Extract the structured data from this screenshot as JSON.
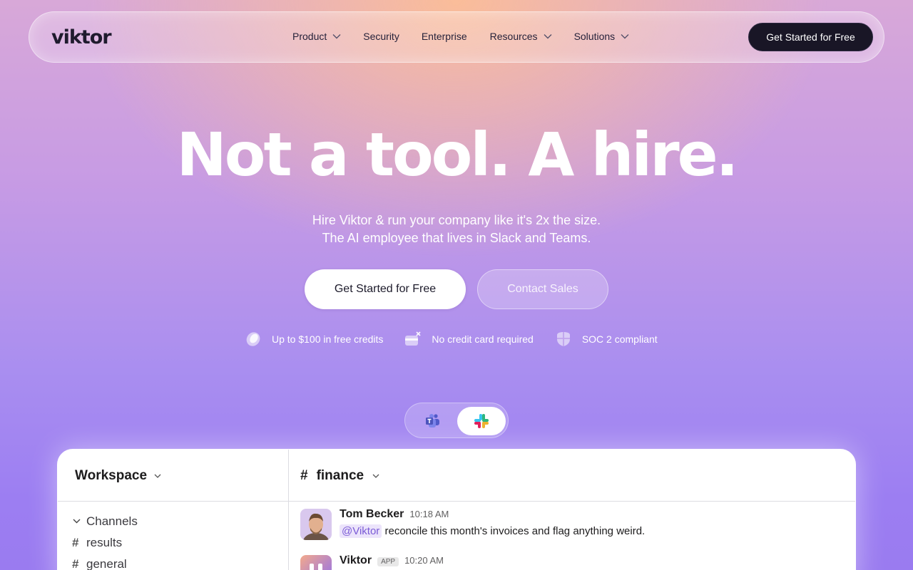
{
  "nav": {
    "logo": "viktor",
    "items": [
      {
        "label": "Product",
        "has_dropdown": true
      },
      {
        "label": "Security",
        "has_dropdown": false
      },
      {
        "label": "Enterprise",
        "has_dropdown": false
      },
      {
        "label": "Resources",
        "has_dropdown": true
      },
      {
        "label": "Solutions",
        "has_dropdown": true
      }
    ],
    "cta": "Get Started for Free"
  },
  "hero": {
    "title": "Not a tool. A hire.",
    "subtitle_line1": "Hire Viktor & run your company like it's 2x the size.",
    "subtitle_line2": "The AI employee that lives in Slack and Teams.",
    "primary_button": "Get Started for Free",
    "secondary_button": "Contact Sales",
    "features": [
      {
        "icon": "coin-icon",
        "label": "Up to $100 in free credits"
      },
      {
        "icon": "no-card-icon",
        "label": "No credit card required"
      },
      {
        "icon": "shield-icon",
        "label": "SOC 2 compliant"
      }
    ]
  },
  "toggle": {
    "options": [
      "teams-logo-icon",
      "slack-logo-icon"
    ],
    "selected": "slack"
  },
  "app": {
    "workspace_title": "Workspace",
    "channel_title": "finance",
    "sidebar": {
      "section": "Channels",
      "channels": [
        "results",
        "general"
      ]
    },
    "messages": [
      {
        "name": "Tom Becker",
        "time": "10:18 AM",
        "mention": "@Viktor",
        "text": "reconcile this month's invoices and flag anything weird."
      },
      {
        "name": "Viktor",
        "badge": "APP",
        "time": "10:20 AM"
      }
    ]
  },
  "colors": {
    "dark_button": "#191626",
    "mention_bg": "#ece4fb",
    "mention_text": "#7b5bd6"
  }
}
